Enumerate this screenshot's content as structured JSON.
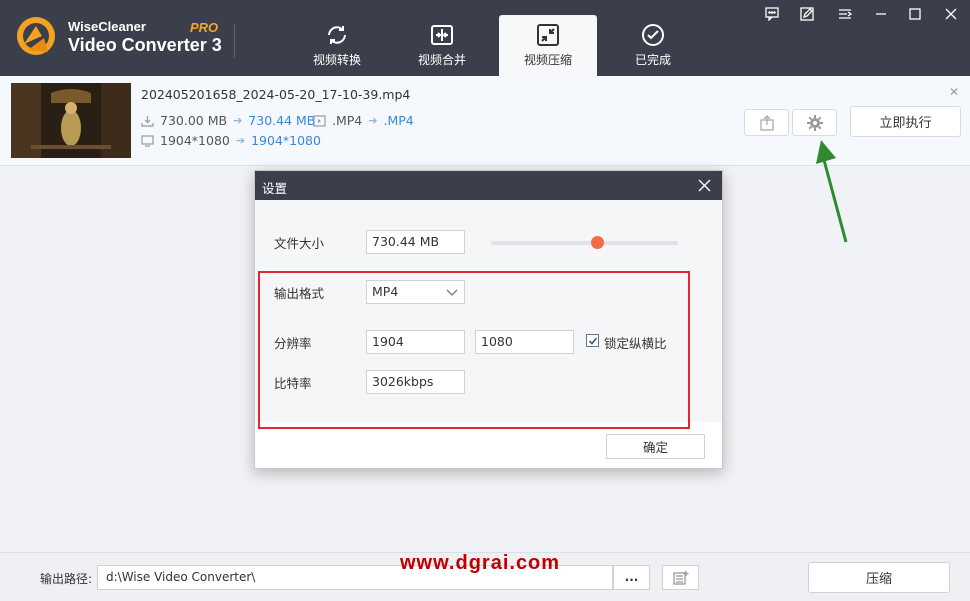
{
  "app": {
    "brand_top": "WiseCleaner",
    "brand_name": "Video Converter 3",
    "brand_tag": "PRO"
  },
  "tabs": [
    {
      "label": "视频转换",
      "icon": "refresh-icon"
    },
    {
      "label": "视频合并",
      "icon": "merge-icon"
    },
    {
      "label": "视频压缩",
      "icon": "compress-icon",
      "active": true
    },
    {
      "label": "已完成",
      "icon": "check-circle-icon"
    }
  ],
  "file": {
    "name": "202405201658_2024-05-20_17-10-39.mp4",
    "size_original": "730.00 MB",
    "size_new": "730.44 MB",
    "format_original": ".MP4",
    "format_new": ".MP4",
    "resolution_original": "1904*1080",
    "resolution_new": "1904*1080",
    "run_label": "立即执行"
  },
  "dialog": {
    "title": "设置",
    "file_size_label": "文件大小",
    "file_size_value": "730.44 MB",
    "file_size_slider_fraction": 0.57,
    "format_label": "输出格式",
    "format_value": "MP4",
    "resolution_label": "分辨率",
    "width_value": "1904",
    "height_value": "1080",
    "lock_aspect_label": "锁定纵横比",
    "lock_aspect_checked": true,
    "bitrate_label": "比特率",
    "bitrate_value": "3026kbps",
    "ok_label": "确定"
  },
  "bottom": {
    "output_label": "输出路径:",
    "output_path": "d:\\Wise Video Converter\\",
    "browse_label": "...",
    "compress_label": "压缩"
  },
  "watermark": "www.dgrai.com",
  "colors": {
    "titlebar": "#3a3f4b",
    "accent_blue": "#3b87d6",
    "slider_thumb": "#f26b4a",
    "annotation_red": "#e0282e",
    "annotation_green": "#2e8b2e",
    "brand_tag": "#f5a623"
  }
}
